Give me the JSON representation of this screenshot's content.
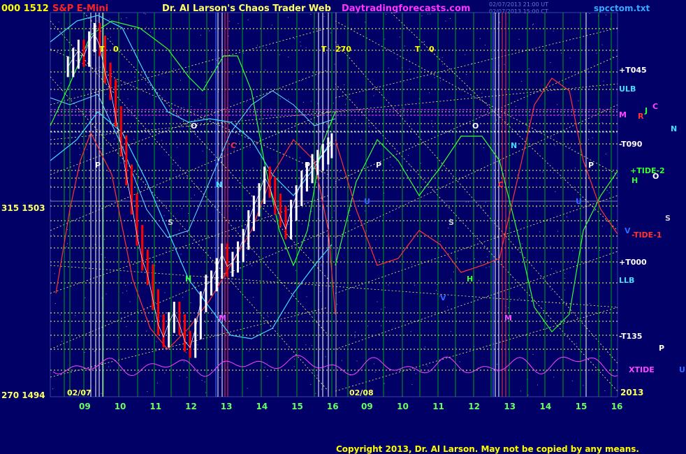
{
  "header": {
    "left_price": "000 1512",
    "instrument": "S&P E-Mini",
    "title": "Dr. Al Larson's Chaos Trader Web",
    "site": "Daytradingforecasts.com",
    "timestamp_line1": "02/07/2013 21:00 UT",
    "timestamp_line2": "02/07/2013 15:00 CT",
    "filename": "spcctom.txt"
  },
  "copyright": "Copyright 2013, Dr. Al Larson. May not be copied by any means.",
  "colors": {
    "background": "#000066",
    "price_up": "#ffffff",
    "price_down": "#ff0000",
    "fib_lines": "#ffff66",
    "time_lines": "#00cc00",
    "xtide": "#ff44ff",
    "tide1": "#ff3333",
    "tide2": "#33ff33",
    "band": "#44ddff"
  },
  "chart_data": {
    "type": "line",
    "instrument": "S&P E-Mini",
    "y_axis_labels": [
      {
        "label": "000 1512",
        "value": 1512
      },
      {
        "label": "315 1503",
        "value": 1503
      },
      {
        "label": "270 1494",
        "value": 1494
      }
    ],
    "ylim": [
      1494,
      1512
    ],
    "x_dates": [
      "02/07",
      "02/08"
    ],
    "x_hour_ticks": [
      "09",
      "10",
      "11",
      "12",
      "13",
      "14",
      "15",
      "16",
      "09",
      "10",
      "11",
      "12",
      "13",
      "14",
      "15",
      "16"
    ],
    "x_year": "2013",
    "right_labels": [
      {
        "text": "+T045",
        "color": "#ffffff"
      },
      {
        "text": "ULB",
        "color": "#44ddff"
      },
      {
        "text": "-T090",
        "color": "#ffffff"
      },
      {
        "text": "+TIDE-2",
        "color": "#33ff33"
      },
      {
        "text": "-TIDE-1",
        "color": "#ff3333"
      },
      {
        "text": "+T000",
        "color": "#ffffff"
      },
      {
        "text": "LLB",
        "color": "#44ddff"
      },
      {
        "text": "-T135",
        "color": "#ffffff"
      },
      {
        "text": "XTIDE",
        "color": "#ff44ff"
      }
    ],
    "planet_letters": [
      {
        "text": "M",
        "color": "#ff44ff"
      },
      {
        "text": "R",
        "color": "#ff3333"
      },
      {
        "text": "J",
        "color": "#33ff33"
      },
      {
        "text": "C",
        "color": "#ff44ff"
      },
      {
        "text": "N",
        "color": "#44ddff"
      },
      {
        "text": "H",
        "color": "#33ff33"
      },
      {
        "text": "O",
        "color": "#ffffff"
      },
      {
        "text": "S",
        "color": "#cccccc"
      },
      {
        "text": "V",
        "color": "#3366ff"
      },
      {
        "text": "P",
        "color": "#ffffff"
      },
      {
        "text": "U",
        "color": "#3366ff"
      }
    ],
    "in_chart_markers": [
      {
        "text": "T",
        "color": "#ffff00"
      },
      {
        "text": "0",
        "color": "#ffff00"
      },
      {
        "text": "T",
        "color": "#ffff00"
      },
      {
        "text": "270",
        "color": "#ffff00"
      },
      {
        "text": "T",
        "color": "#ffff00"
      },
      {
        "text": "0",
        "color": "#ffff00"
      },
      {
        "text": "P",
        "color": "#ffffff"
      },
      {
        "text": "O",
        "color": "#ffffff"
      },
      {
        "text": "N",
        "color": "#44ddff"
      },
      {
        "text": "C",
        "color": "#ff3333"
      },
      {
        "text": "S",
        "color": "#cccccc"
      },
      {
        "text": "H",
        "color": "#33ff33"
      },
      {
        "text": "M",
        "color": "#ff44ff"
      },
      {
        "text": "P",
        "color": "#ffffff"
      },
      {
        "text": "U",
        "color": "#3366ff"
      },
      {
        "text": "P",
        "color": "#ffffff"
      },
      {
        "text": "O",
        "color": "#ffffff"
      },
      {
        "text": "C",
        "color": "#ff3333"
      },
      {
        "text": "N",
        "color": "#44ddff"
      },
      {
        "text": "S",
        "color": "#cccccc"
      },
      {
        "text": "V",
        "color": "#3366ff"
      },
      {
        "text": "H",
        "color": "#33ff33"
      },
      {
        "text": "M",
        "color": "#ff44ff"
      },
      {
        "text": "U",
        "color": "#3366ff"
      },
      {
        "text": "P",
        "color": "#ffffff"
      }
    ],
    "price_series": {
      "name": "",
      "x_hours": [
        8.55,
        8.7,
        8.85,
        9.0,
        9.15,
        9.3,
        9.45,
        9.6,
        9.75,
        9.9,
        10.05,
        10.2,
        10.35,
        10.5,
        10.65,
        10.8,
        10.95,
        11.1,
        11.25,
        11.4,
        11.55,
        11.7,
        11.85,
        12.0,
        12.15,
        12.3,
        12.45,
        12.6,
        12.75,
        12.9,
        13.05,
        13.2,
        13.35,
        13.5,
        13.65,
        13.8,
        13.95,
        14.1,
        14.25,
        14.4,
        14.55,
        14.7,
        14.85,
        15.0,
        15.15,
        15.3,
        15.45,
        15.6,
        15.75,
        15.9,
        16.0
      ],
      "close": [
        1509.8,
        1510.2,
        1510.6,
        1510.3,
        1511.0,
        1511.4,
        1510.8,
        1509.5,
        1508.7,
        1507.4,
        1506.0,
        1504.6,
        1503.2,
        1501.7,
        1500.5,
        1499.8,
        1498.6,
        1497.4,
        1496.8,
        1497.5,
        1498.0,
        1497.4,
        1496.6,
        1496.3,
        1497.2,
        1498.5,
        1499.3,
        1499.5,
        1500.1,
        1500.8,
        1500.2,
        1500.4,
        1500.9,
        1501.5,
        1502.4,
        1503.1,
        1503.7,
        1504.5,
        1504.0,
        1503.2,
        1502.6,
        1502.0,
        1502.9,
        1503.6,
        1504.3,
        1504.7,
        1505.1,
        1505.3,
        1505.6,
        1505.9,
        1506.1
      ]
    }
  }
}
